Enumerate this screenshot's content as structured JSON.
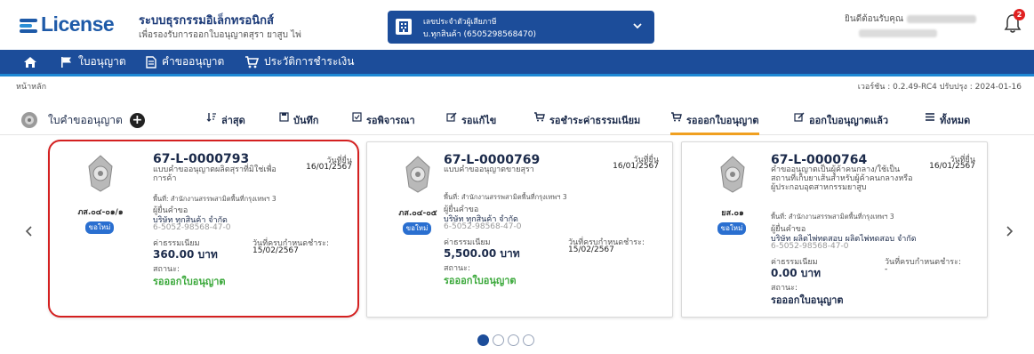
{
  "header": {
    "logo_text": "License",
    "title": "ระบบธุรกรรมอิเล็กทรอนิกส์",
    "subtitle": "เพื่อรองรับการออกใบอนุญาตสุรา ยาสูบ ไพ่",
    "taxpayer_label": "เลขประจำตัวผู้เสียภาษี",
    "taxpayer_value": "บ.ทุกสินค้า (6505298568470)",
    "welcome": "ยินดีต้อนรับคุณ",
    "notification_count": "2"
  },
  "nav": {
    "items": [
      {
        "label": ""
      },
      {
        "label": "ใบอนุญาต"
      },
      {
        "label": "คำขออนุญาต"
      },
      {
        "label": "ประวัติการชำระเงิน"
      }
    ]
  },
  "breadcrumb": "หน้าหลัก",
  "version": "เวอร์ชัน : 0.2.49-RC4 ปรับปรุง : 2024-01-16",
  "requests_header": "ใบคำขออนุญาต",
  "tabs": [
    {
      "label": "ล่าสุด"
    },
    {
      "label": "บันทึก"
    },
    {
      "label": "รอพิจารณา"
    },
    {
      "label": "รอแก้ไข"
    },
    {
      "label": "รอชำระค่าธรรมเนียม"
    },
    {
      "label": "รอออกใบอนุญาต"
    },
    {
      "label": "ออกใบอนุญาตแล้ว"
    },
    {
      "label": "ทั้งหมด"
    }
  ],
  "cards": [
    {
      "form_code": "ภส.๐๔-๐๑/๑",
      "new_label": "ขอใหม่",
      "request_no": "67-L-0000793",
      "description": "แบบคำขออนุญาตผลิตสุราที่มิใช่เพื่อการค้า",
      "submit_label": "วันที่ยื่น",
      "submit_date": "16/01/2567",
      "area": "พื้นที่: สำนักงานสรรพสามิตพื้นที่กรุงเทพฯ 3",
      "applicant_label": "ผู้ยื่นคำขอ",
      "company": "บริษัท ทุกสินค้า จำกัด",
      "tax_id": "6-5052-98568-47-0",
      "fee_label": "ค่าธรรมเนียม",
      "fee": "360.00 บาท",
      "due_label": "วันที่ครบกำหนดชำระ:",
      "due_date": "15/02/2567",
      "status_label": "สถานะ:",
      "status": "รอออกใบอนุญาต",
      "status_color": "#3aa83a"
    },
    {
      "form_code": "ภส.๐๔-๐๕",
      "new_label": "ขอใหม่",
      "request_no": "67-L-0000769",
      "description": "แบบคำขออนุญาตขายสุรา",
      "submit_label": "วันที่ยื่น",
      "submit_date": "16/01/2567",
      "area": "พื้นที่: สำนักงานสรรพสามิตพื้นที่กรุงเทพฯ 3",
      "applicant_label": "ผู้ยื่นคำขอ",
      "company": "บริษัท ทุกสินค้า จำกัด",
      "tax_id": "6-5052-98568-47-0",
      "fee_label": "ค่าธรรมเนียม",
      "fee": "5,500.00 บาท",
      "due_label": "วันที่ครบกำหนดชำระ:",
      "due_date": "15/02/2567",
      "status_label": "สถานะ:",
      "status": "รอออกใบอนุญาต",
      "status_color": "#3aa83a"
    },
    {
      "form_code": "ยส.๐๑",
      "new_label": "ขอใหม่",
      "request_no": "67-L-0000764",
      "description": "คำขออนุญาตเป็นผู้ค้าคนกลาง/ใช้เป็นสถานที่เก็บยาเส้นสำหรับผู้ค้าคนกลางหรือผู้ประกอบอุตสาหกรรมยาสูบ",
      "submit_label": "วันที่ยื่น",
      "submit_date": "16/01/2567",
      "area": "พื้นที่: สำนักงานสรรพสามิตพื้นที่กรุงเทพฯ 3",
      "applicant_label": "ผู้ยื่นคำขอ",
      "company": "บริษัท ผลิตไพ่ทดสอบ ผลิตไพ่ทดสอบ จำกัด",
      "tax_id": "6-5052-98568-47-0",
      "fee_label": "ค่าธรรมเนียม",
      "fee": "0.00 บาท",
      "due_label": "วันที่ครบกำหนดชำระ:",
      "due_date": "-",
      "status_label": "สถานะ:",
      "status": "รอออกใบอนุญาต",
      "status_color": "#1b2a4a"
    }
  ],
  "pagination": {
    "current": 1,
    "total": 4
  },
  "colors": {
    "brand": "#1c4d9a",
    "accent_tab": "#f0a020",
    "selected_outline": "#d42020",
    "status_green": "#3aa83a"
  },
  "icons": [
    "home-icon",
    "flag-icon",
    "document-icon",
    "cart-icon",
    "bell-icon",
    "building-icon",
    "chevron-down-icon",
    "plus-icon",
    "sort-icon",
    "save-icon",
    "checkbox-icon",
    "edit-icon",
    "list-icon",
    "chevron-left-icon",
    "chevron-right-icon",
    "emblem-icon"
  ]
}
